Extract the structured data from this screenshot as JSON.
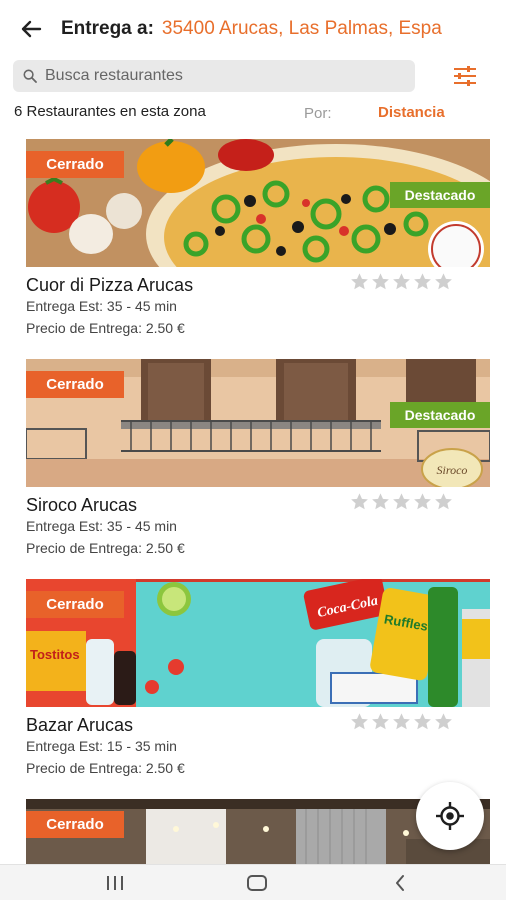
{
  "header": {
    "back_icon": "arrow-left-icon",
    "label": "Entrega a:",
    "address": "35400 Arucas, Las Palmas, Espa"
  },
  "search": {
    "placeholder": "Busca restaurantes",
    "value": "",
    "filter_icon": "sliders-icon"
  },
  "listing": {
    "count_text": "6 Restaurantes en esta zona",
    "sort_label": "Por:",
    "sort_value": "Distancia"
  },
  "colors": {
    "accent": "#e86f2c",
    "closed_badge": "#e8622a",
    "featured_badge": "#6aa528",
    "star": "#cfcfcf"
  },
  "restaurants": [
    {
      "name": "Cuor di Pizza Arucas",
      "status": "Cerrado",
      "featured": "Destacado",
      "delivery_time": "Entrega Est: 35 - 45 min",
      "delivery_price": "Precio de Entrega: 2.50 €",
      "rating": 0,
      "logo_text": "Cuor di Pizza"
    },
    {
      "name": "Siroco Arucas",
      "status": "Cerrado",
      "featured": "Destacado",
      "delivery_time": "Entrega Est: 35 - 45 min",
      "delivery_price": "Precio de Entrega: 2.50 €",
      "rating": 0,
      "logo_text": "Siroco"
    },
    {
      "name": "Bazar Arucas",
      "status": "Cerrado",
      "delivery_time": "Entrega Est: 15 - 35 min",
      "delivery_price": "Precio de Entrega: 2.50 €",
      "rating": 0,
      "brand_texts": [
        "Coca-Cola",
        "Tostitos",
        "Ruffles"
      ]
    },
    {
      "status": "Cerrado"
    }
  ],
  "locate_icon": "my-location-icon",
  "navbar": {
    "icons": [
      "recent-apps-icon",
      "home-icon",
      "back-icon"
    ]
  }
}
